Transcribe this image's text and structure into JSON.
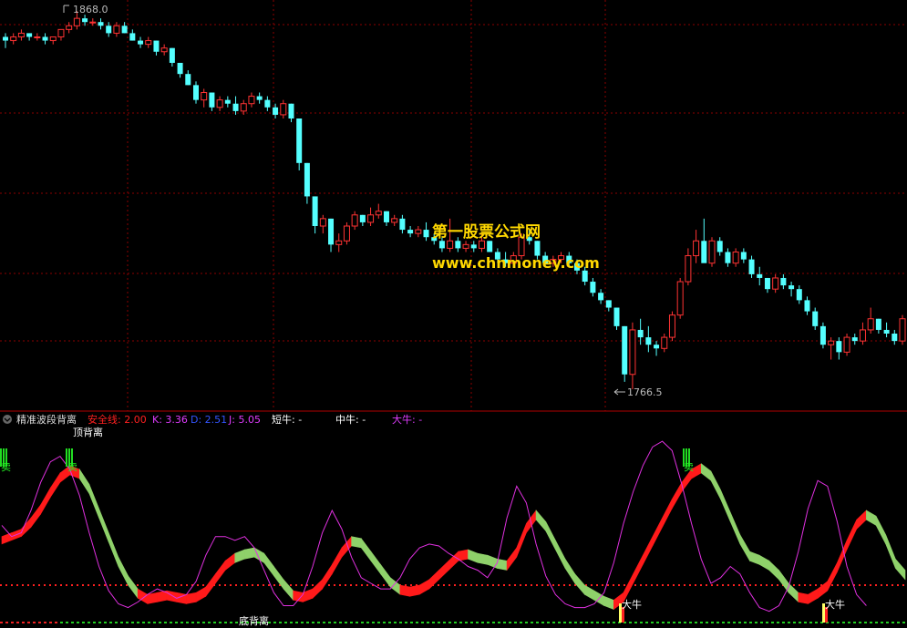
{
  "price_panel": {
    "high_label": "1868.0",
    "low_label": "1766.5",
    "watermark_cn": "第一股票公式网",
    "watermark_url": "www.chnmoney.com"
  },
  "indicator_header": {
    "name": "精准波段背离",
    "safety_line": "安全线: 2.00",
    "k": "K: 3.36",
    "d": "D: 2.51",
    "j": "J: 5.05",
    "short_bull": "短牛: -",
    "mid_bull": "中牛: -",
    "big_bull": "大牛: -"
  },
  "annotations": {
    "top_divergence": "顶背离",
    "bottom_divergence": "底背离",
    "sell": "卖",
    "big_bull": "大牛"
  },
  "colors": {
    "up": "#ff3333",
    "down": "#54ffff",
    "ribbon_up": "#ff1a1a",
    "ribbon_down": "#8fd16a",
    "fast_line": "#e030e0",
    "safety": "#ff2020",
    "grid": "#8b0000",
    "k_color": "#e03cff",
    "d_color": "#3355ff",
    "short_color": "#ffffff",
    "big_color": "#e03cff"
  },
  "chart_data": [
    {
      "type": "candlestick",
      "title": "",
      "y_labels": [
        "1868.0",
        "1766.5"
      ],
      "candles": [
        [
          1861,
          1862,
          1858,
          1860
        ],
        [
          1860,
          1862,
          1859,
          1861
        ],
        [
          1861,
          1863,
          1860,
          1862
        ],
        [
          1862,
          1862,
          1860,
          1861
        ],
        [
          1861,
          1862,
          1860,
          1861
        ],
        [
          1861,
          1862,
          1859,
          1860
        ],
        [
          1860,
          1861,
          1859,
          1861
        ],
        [
          1861,
          1863,
          1860,
          1863
        ],
        [
          1863,
          1865,
          1862,
          1864
        ],
        [
          1864,
          1868,
          1863,
          1866
        ],
        [
          1866,
          1867,
          1864,
          1865
        ],
        [
          1865,
          1866,
          1864,
          1865
        ],
        [
          1865,
          1866,
          1863,
          1864
        ],
        [
          1864,
          1865,
          1861,
          1862
        ],
        [
          1862,
          1865,
          1861,
          1864
        ],
        [
          1864,
          1865,
          1862,
          1862
        ],
        [
          1862,
          1863,
          1860,
          1860
        ],
        [
          1860,
          1861,
          1858,
          1859
        ],
        [
          1859,
          1861,
          1858,
          1860
        ],
        [
          1860,
          1860,
          1856,
          1857
        ],
        [
          1857,
          1859,
          1856,
          1858
        ],
        [
          1858,
          1858,
          1853,
          1854
        ],
        [
          1854,
          1854,
          1850,
          1851
        ],
        [
          1851,
          1852,
          1848,
          1848
        ],
        [
          1848,
          1849,
          1843,
          1844
        ],
        [
          1844,
          1847,
          1842,
          1846
        ],
        [
          1846,
          1846,
          1841,
          1842
        ],
        [
          1842,
          1845,
          1841,
          1844
        ],
        [
          1844,
          1845,
          1842,
          1843
        ],
        [
          1843,
          1845,
          1840,
          1841
        ],
        [
          1841,
          1844,
          1840,
          1843
        ],
        [
          1843,
          1846,
          1842,
          1845
        ],
        [
          1845,
          1846,
          1843,
          1844
        ],
        [
          1844,
          1845,
          1841,
          1842
        ],
        [
          1842,
          1843,
          1839,
          1840
        ],
        [
          1840,
          1844,
          1839,
          1843
        ],
        [
          1843,
          1843,
          1838,
          1839
        ],
        [
          1839,
          1839,
          1825,
          1827
        ],
        [
          1827,
          1827,
          1816,
          1818
        ],
        [
          1818,
          1818,
          1808,
          1810
        ],
        [
          1810,
          1813,
          1808,
          1812
        ],
        [
          1812,
          1812,
          1803,
          1805
        ],
        [
          1805,
          1808,
          1803,
          1806
        ],
        [
          1806,
          1811,
          1805,
          1810
        ],
        [
          1810,
          1814,
          1809,
          1813
        ],
        [
          1813,
          1813,
          1810,
          1811
        ],
        [
          1811,
          1815,
          1810,
          1813
        ],
        [
          1813,
          1816,
          1812,
          1814
        ],
        [
          1814,
          1814,
          1810,
          1811
        ],
        [
          1811,
          1813,
          1810,
          1812
        ],
        [
          1812,
          1813,
          1808,
          1809
        ],
        [
          1809,
          1810,
          1807,
          1808
        ],
        [
          1808,
          1810,
          1807,
          1809
        ],
        [
          1809,
          1811,
          1806,
          1807
        ],
        [
          1807,
          1808,
          1805,
          1806
        ],
        [
          1806,
          1807,
          1803,
          1804
        ],
        [
          1804,
          1812,
          1803,
          1806
        ],
        [
          1806,
          1807,
          1803,
          1804
        ],
        [
          1804,
          1806,
          1803,
          1805
        ],
        [
          1805,
          1806,
          1803,
          1804
        ],
        [
          1804,
          1808,
          1803,
          1806
        ],
        [
          1806,
          1806,
          1803,
          1803
        ],
        [
          1803,
          1804,
          1800,
          1801
        ],
        [
          1801,
          1803,
          1799,
          1800
        ],
        [
          1800,
          1803,
          1799,
          1802
        ],
        [
          1802,
          1808,
          1801,
          1807
        ],
        [
          1807,
          1809,
          1805,
          1806
        ],
        [
          1806,
          1806,
          1801,
          1802
        ],
        [
          1802,
          1803,
          1799,
          1800
        ],
        [
          1800,
          1802,
          1799,
          1801
        ],
        [
          1801,
          1803,
          1800,
          1802
        ],
        [
          1802,
          1803,
          1799,
          1800
        ],
        [
          1800,
          1801,
          1797,
          1798
        ],
        [
          1798,
          1799,
          1794,
          1795
        ],
        [
          1795,
          1796,
          1791,
          1792
        ],
        [
          1792,
          1793,
          1789,
          1790
        ],
        [
          1790,
          1790,
          1787,
          1788
        ],
        [
          1788,
          1788,
          1782,
          1783
        ],
        [
          1783,
          1783,
          1768,
          1770
        ],
        [
          1770,
          1784,
          1766,
          1782
        ],
        [
          1782,
          1785,
          1778,
          1780
        ],
        [
          1780,
          1783,
          1776,
          1778
        ],
        [
          1778,
          1779,
          1775,
          1777
        ],
        [
          1777,
          1781,
          1776,
          1780
        ],
        [
          1780,
          1787,
          1779,
          1786
        ],
        [
          1786,
          1796,
          1785,
          1795
        ],
        [
          1795,
          1804,
          1794,
          1802
        ],
        [
          1802,
          1809,
          1800,
          1806
        ],
        [
          1806,
          1812,
          1804,
          1800
        ],
        [
          1800,
          1807,
          1799,
          1806
        ],
        [
          1806,
          1807,
          1802,
          1803
        ],
        [
          1803,
          1804,
          1799,
          1800
        ],
        [
          1800,
          1804,
          1799,
          1803
        ],
        [
          1803,
          1804,
          1800,
          1801
        ],
        [
          1801,
          1802,
          1796,
          1797
        ],
        [
          1797,
          1799,
          1794,
          1796
        ],
        [
          1796,
          1796,
          1792,
          1793
        ],
        [
          1793,
          1797,
          1792,
          1796
        ],
        [
          1796,
          1797,
          1793,
          1794
        ],
        [
          1794,
          1795,
          1791,
          1793
        ],
        [
          1793,
          1794,
          1789,
          1790
        ],
        [
          1790,
          1791,
          1786,
          1787
        ],
        [
          1787,
          1788,
          1782,
          1783
        ],
        [
          1783,
          1784,
          1777,
          1778
        ],
        [
          1778,
          1780,
          1774,
          1779
        ],
        [
          1779,
          1780,
          1774,
          1776
        ],
        [
          1776,
          1781,
          1775,
          1780
        ],
        [
          1780,
          1781,
          1778,
          1779
        ],
        [
          1779,
          1784,
          1778,
          1782
        ],
        [
          1782,
          1788,
          1781,
          1785
        ],
        [
          1785,
          1785,
          1781,
          1782
        ],
        [
          1782,
          1784,
          1780,
          1781
        ],
        [
          1781,
          1782,
          1778,
          1779
        ],
        [
          1779,
          1786,
          1778,
          1785
        ]
      ]
    },
    {
      "type": "line",
      "title": "精准波段背离",
      "safety_line": 2.0,
      "ylim": [
        0,
        10
      ],
      "ribbon_top": [
        4.6,
        4.8,
        5.0,
        5.6,
        6.3,
        7.2,
        8.0,
        8.4,
        8.2,
        7.4,
        6.1,
        4.8,
        3.5,
        2.5,
        1.8,
        1.5,
        1.6,
        1.7,
        1.6,
        1.5,
        1.6,
        1.9,
        2.6,
        3.3,
        3.7,
        3.9,
        4.0,
        3.7,
        3.0,
        2.3,
        1.7,
        1.6,
        1.8,
        2.3,
        3.1,
        4.0,
        4.6,
        4.5,
        3.8,
        3.1,
        2.4,
        2.0,
        1.9,
        2.0,
        2.3,
        2.8,
        3.3,
        3.8,
        3.9,
        3.7,
        3.6,
        3.4,
        3.3,
        4.0,
        5.3,
        6.0,
        5.4,
        4.4,
        3.4,
        2.6,
        2.0,
        1.7,
        1.4,
        1.2,
        1.6,
        2.6,
        3.6,
        4.6,
        5.6,
        6.6,
        7.5,
        8.2,
        8.5,
        8.1,
        7.1,
        5.9,
        4.7,
        3.8,
        3.6,
        3.3,
        2.8,
        2.1,
        1.6,
        1.5,
        1.8,
        2.2,
        3.2,
        4.4,
        5.5,
        6.0,
        5.7,
        4.7,
        3.4,
        2.8
      ],
      "ribbon_bottom": [
        4.4,
        4.6,
        4.8,
        5.3,
        6.0,
        6.9,
        7.7,
        8.1,
        7.9,
        7.1,
        5.8,
        4.5,
        3.2,
        2.2,
        1.5,
        1.2,
        1.3,
        1.4,
        1.3,
        1.2,
        1.3,
        1.6,
        2.3,
        3.0,
        3.4,
        3.6,
        3.7,
        3.4,
        2.7,
        2.0,
        1.4,
        1.3,
        1.5,
        2.0,
        2.8,
        3.7,
        4.3,
        4.2,
        3.5,
        2.8,
        2.1,
        1.7,
        1.6,
        1.7,
        2.0,
        2.5,
        3.0,
        3.5,
        3.6,
        3.4,
        3.3,
        3.1,
        3.0,
        3.7,
        5.0,
        5.7,
        5.1,
        4.1,
        3.1,
        2.3,
        1.7,
        1.4,
        1.1,
        0.9,
        1.3,
        2.3,
        3.3,
        4.3,
        5.3,
        6.3,
        7.2,
        7.9,
        8.2,
        7.8,
        6.8,
        5.6,
        4.4,
        3.5,
        3.3,
        3.0,
        2.5,
        1.8,
        1.3,
        1.2,
        1.5,
        1.9,
        2.9,
        4.1,
        5.2,
        5.7,
        5.4,
        4.4,
        3.1,
        2.5
      ],
      "fast_line": [
        5.2,
        4.6,
        4.8,
        6.0,
        7.5,
        8.6,
        8.9,
        8.2,
        6.8,
        4.8,
        3.0,
        1.7,
        1.0,
        0.8,
        1.1,
        1.5,
        1.8,
        1.6,
        1.3,
        1.5,
        2.2,
        3.6,
        4.6,
        4.6,
        4.4,
        4.6,
        4.0,
        2.8,
        1.6,
        0.9,
        0.9,
        1.5,
        3.0,
        4.8,
        6.0,
        5.0,
        3.5,
        2.4,
        2.1,
        1.8,
        1.8,
        2.4,
        3.4,
        4.0,
        4.2,
        4.1,
        3.7,
        3.4,
        3.0,
        2.8,
        2.4,
        3.2,
        5.6,
        7.3,
        6.4,
        4.2,
        2.5,
        1.5,
        1.0,
        0.8,
        0.8,
        1.0,
        1.6,
        3.2,
        5.3,
        7.0,
        8.4,
        9.4,
        9.7,
        9.2,
        7.4,
        5.3,
        3.4,
        2.1,
        2.4,
        3.0,
        2.6,
        1.6,
        0.8,
        0.6,
        0.9,
        1.9,
        3.8,
        6.1,
        7.6,
        7.3,
        5.4,
        3.0,
        1.5,
        0.9
      ],
      "up_segments": [
        [
          0,
          8
        ],
        [
          14,
          24
        ],
        [
          30,
          36
        ],
        [
          41,
          48
        ],
        [
          52,
          55
        ],
        [
          63,
          72
        ],
        [
          82,
          89
        ]
      ]
    }
  ]
}
